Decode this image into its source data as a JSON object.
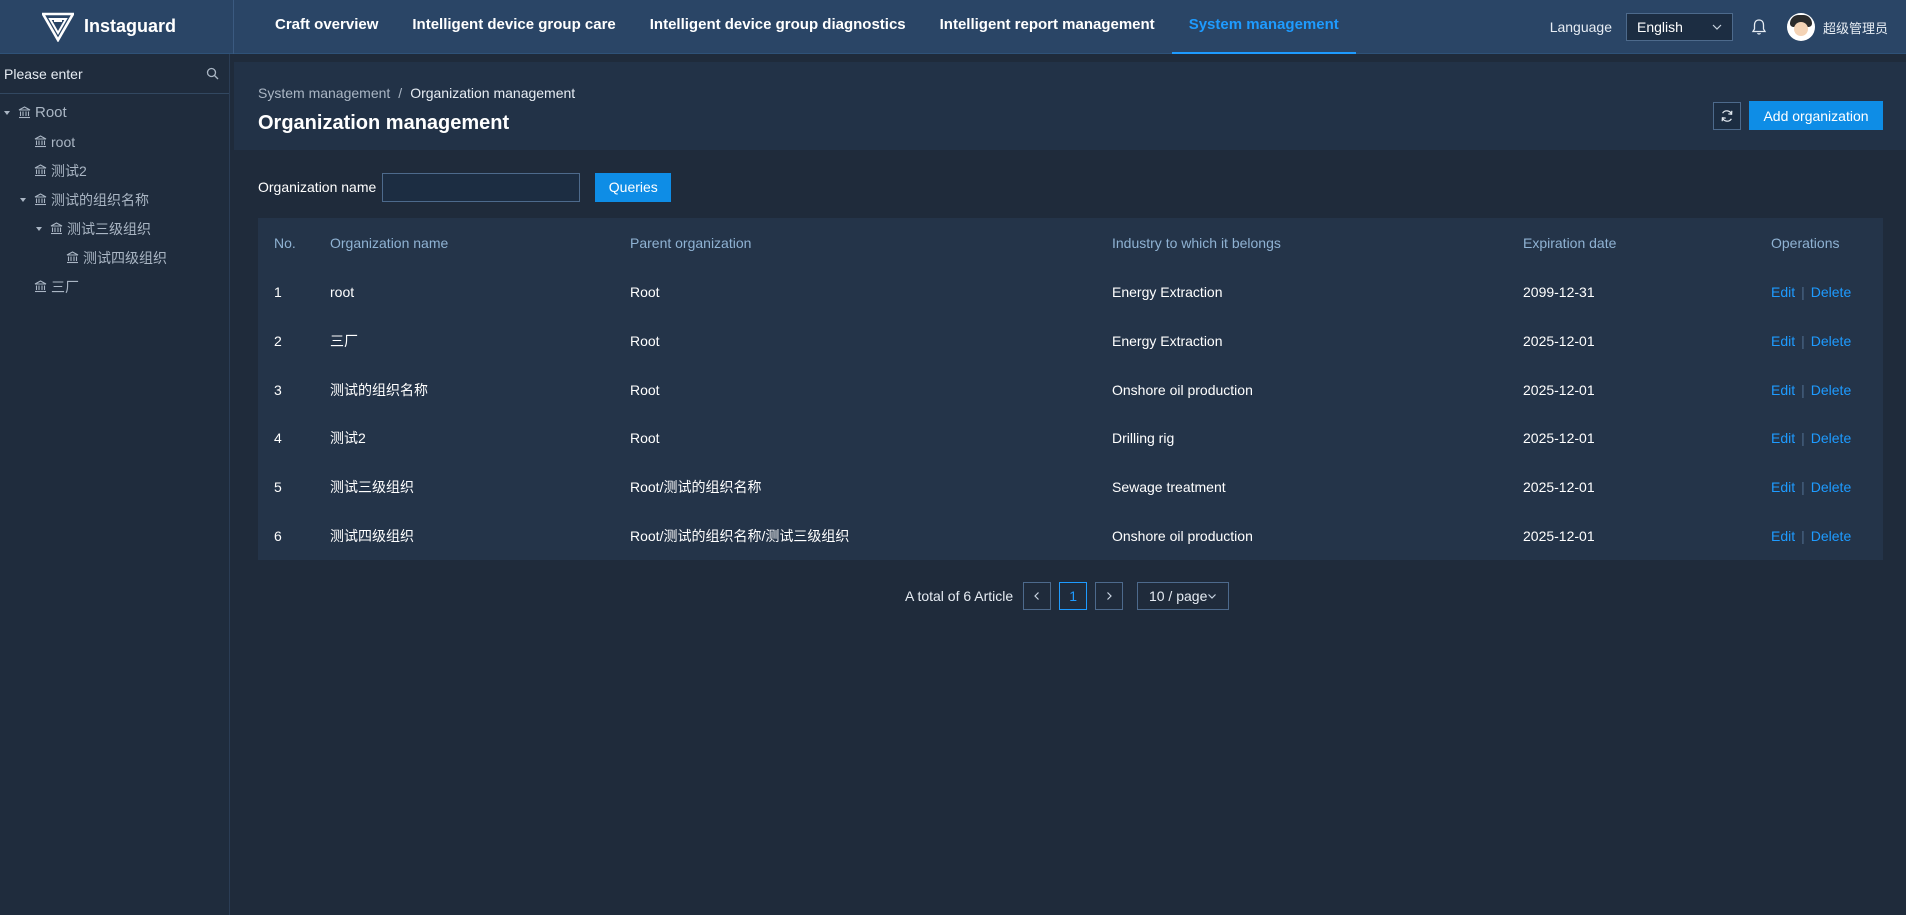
{
  "app": {
    "name": "Instaguard",
    "colors": {
      "accent": "#1e9bff",
      "topbar": "#2a4566",
      "background": "#1f2b3b",
      "panel": "#243449"
    }
  },
  "topnav": {
    "items": [
      {
        "label": "Craft overview",
        "active": false
      },
      {
        "label": "Intelligent device group care",
        "active": false
      },
      {
        "label": "Intelligent device group diagnostics",
        "active": false
      },
      {
        "label": "Intelligent report management",
        "active": false
      },
      {
        "label": "System management",
        "active": true
      }
    ],
    "language_label": "Language",
    "language_value": "English",
    "username": "超级管理员"
  },
  "sidebar": {
    "search_placeholder": "Please enter",
    "tree": [
      {
        "label": "Root",
        "level": 0,
        "expanded": true
      },
      {
        "label": "root",
        "level": 1
      },
      {
        "label": "测试2",
        "level": 1
      },
      {
        "label": "测试的组织名称",
        "level": 1,
        "expanded": true
      },
      {
        "label": "测试三级组织",
        "level": 2,
        "expanded": true
      },
      {
        "label": "测试四级组织",
        "level": 3
      },
      {
        "label": "三厂",
        "level": 1
      }
    ]
  },
  "header": {
    "breadcrumb": [
      "System management",
      "Organization management"
    ],
    "breadcrumb_separator": "/",
    "title": "Organization management",
    "add_label": "Add organization"
  },
  "filter": {
    "label": "Organization name",
    "value": "",
    "query_label": "Queries"
  },
  "table": {
    "columns": [
      "No.",
      "Organization name",
      "Parent organization",
      "Industry to which it belongs",
      "Expiration date",
      "Operations"
    ],
    "edit_label": "Edit",
    "delete_label": "Delete",
    "op_separator": "|",
    "rows": [
      {
        "no": "1",
        "name": "root",
        "parent": "Root",
        "industry": "Energy Extraction",
        "expires": "2099-12-31"
      },
      {
        "no": "2",
        "name": "三厂",
        "parent": "Root",
        "industry": "Energy Extraction",
        "expires": "2025-12-01"
      },
      {
        "no": "3",
        "name": "测试的组织名称",
        "parent": "Root",
        "industry": "Onshore oil production",
        "expires": "2025-12-01"
      },
      {
        "no": "4",
        "name": "测试2",
        "parent": "Root",
        "industry": "Drilling rig",
        "expires": "2025-12-01"
      },
      {
        "no": "5",
        "name": "测试三级组织",
        "parent": "Root/测试的组织名称",
        "industry": "Sewage treatment",
        "expires": "2025-12-01"
      },
      {
        "no": "6",
        "name": "测试四级组织",
        "parent": "Root/测试的组织名称/测试三级组织",
        "industry": "Onshore oil production",
        "expires": "2025-12-01"
      }
    ]
  },
  "pagination": {
    "total_text": "A total of 6 Article",
    "current_page": "1",
    "page_size": "10 / page"
  }
}
